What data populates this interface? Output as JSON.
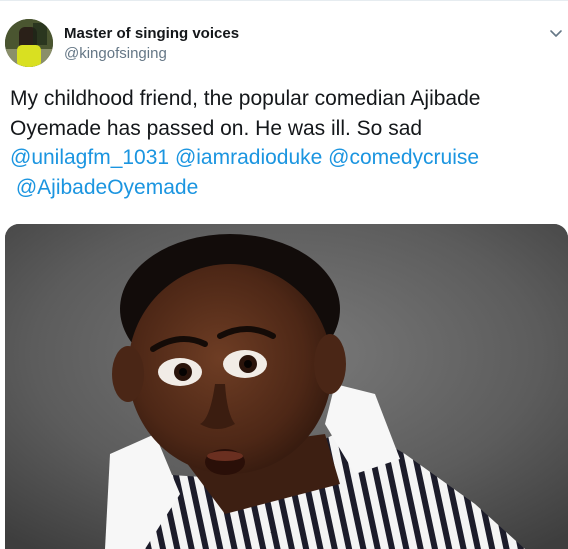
{
  "tweet": {
    "author": {
      "display_name": "Master of singing voices",
      "handle": "@kingofsinging"
    },
    "text": {
      "line1": "My childhood friend, the popular comedian Ajibade",
      "line2": "Oyemade has passed on. He was ill. So sad",
      "mentions": [
        "@unilagfm_1031",
        "@iamradioduke",
        "@comedycruise",
        "@AjibadeOyemade"
      ]
    },
    "menu_icon": "chevron-down-icon",
    "colors": {
      "link": "#1b95e0",
      "secondary_text": "#657786",
      "primary_text": "#14171a"
    }
  }
}
